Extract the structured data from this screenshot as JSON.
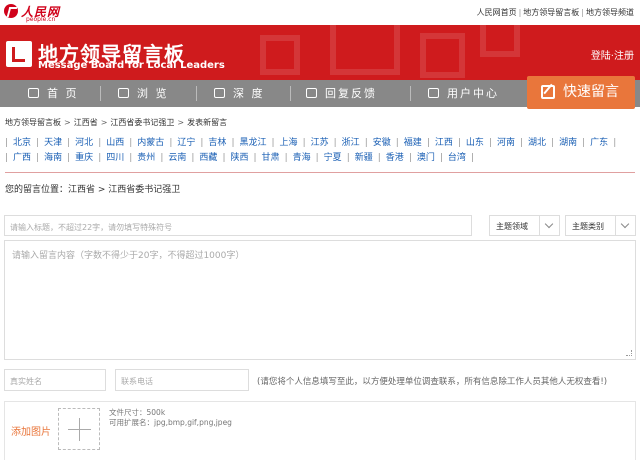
{
  "topbar": {
    "logo_cn": "人民网",
    "logo_en": "people.cn",
    "links": [
      "人民网首页",
      "地方领导留言板",
      "地方领导频道"
    ],
    "sep": "|"
  },
  "banner": {
    "title": "地方领导留言板",
    "subtitle": "Message Board for Local Leaders",
    "login": "登陆·注册"
  },
  "nav": {
    "items": [
      {
        "label": "首 页",
        "icon": "home-icon"
      },
      {
        "label": "浏 览",
        "icon": "browse-icon"
      },
      {
        "label": "深 度",
        "icon": "depth-icon"
      },
      {
        "label": "回复反馈",
        "icon": "reply-icon"
      },
      {
        "label": "用户中心",
        "icon": "user-icon"
      }
    ],
    "quick": "快速留言"
  },
  "breadcrumb": [
    "地方领导留言板",
    "江西省",
    "江西省委书记强卫",
    "发表新留言"
  ],
  "provinces": {
    "row1": [
      "北京",
      "天津",
      "河北",
      "山西",
      "内蒙古",
      "辽宁",
      "吉林",
      "黑龙江",
      "上海",
      "江苏",
      "浙江",
      "安徽",
      "福建",
      "江西",
      "山东",
      "河南",
      "湖北",
      "湖南",
      "广东"
    ],
    "row2": [
      "广西",
      "海南",
      "重庆",
      "四川",
      "贵州",
      "云南",
      "西藏",
      "陕西",
      "甘肃",
      "青海",
      "宁夏",
      "新疆",
      "香港",
      "澳门",
      "台湾"
    ]
  },
  "location": {
    "prefix": "您的留言位置：",
    "path": "江西省 > 江西省委书记强卫"
  },
  "form": {
    "subject_placeholder": "请输入标题，不超过22字，请勿填写特殊符号",
    "domain_select": "主题领域",
    "category_select": "主题类别",
    "content_placeholder": "请输入留言内容（字数不得少于20字，不得超过1000字）",
    "name_placeholder": "真实姓名",
    "phone_placeholder": "联系电话",
    "privacy_note": "(请您将个人信息填写至此，以方便处理单位调查联系，所有信息除工作人员其他人无权查看!)",
    "upload_label": "添加图片",
    "file_size": "文件尺寸：500k",
    "file_ext": "可用扩展名：jpg,bmp,gif,png,jpeg"
  }
}
